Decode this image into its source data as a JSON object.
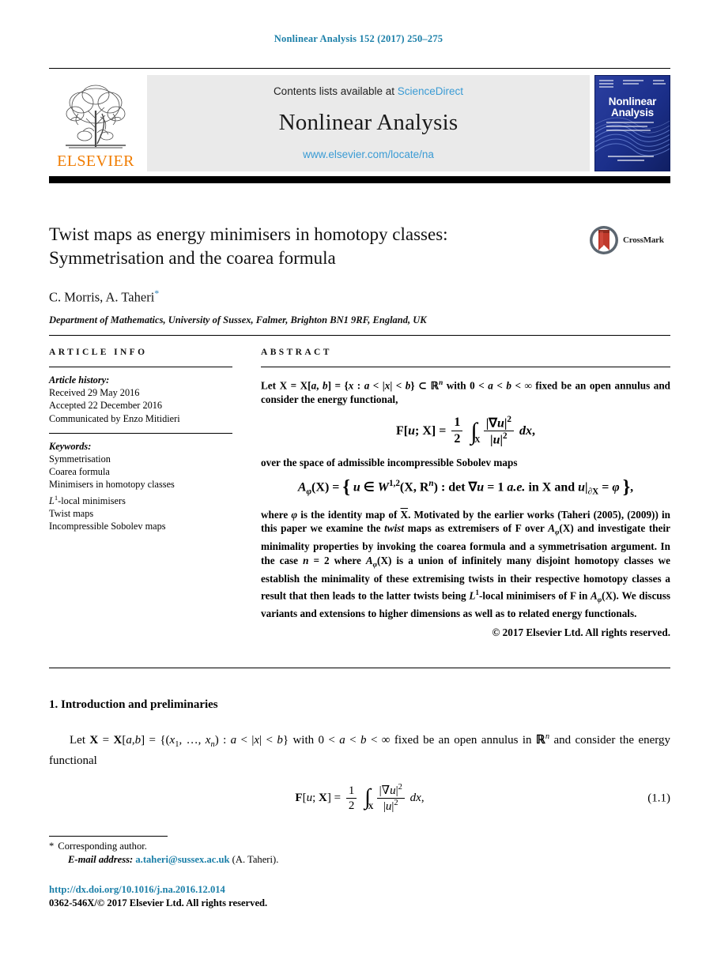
{
  "running_head": "Nonlinear Analysis 152 (2017) 250–275",
  "masthead": {
    "contents_text": "Contents lists available at ",
    "sciencedirect": "ScienceDirect",
    "journal_title": "Nonlinear Analysis",
    "journal_url": "www.elsevier.com/locate/na",
    "publisher_wordmark": "ELSEVIER",
    "cover_title_line1": "Nonlinear",
    "cover_title_line2": "Analysis",
    "link_color": "#3a9bd4",
    "cover_color": "#1b2f8a",
    "elsevier_orange": "#f07c00"
  },
  "article": {
    "title_line1": "Twist maps as energy minimisers in homotopy classes:",
    "title_line2": "Symmetrisation and the coarea formula",
    "authors": "C. Morris, A. Taheri",
    "author_star": "*",
    "affiliation": "Department of Mathematics, University of Sussex, Falmer, Brighton BN1 9RF, England, UK",
    "crossmark_label": "CrossMark"
  },
  "info": {
    "heading": "ARTICLE INFO",
    "history_label": "Article history:",
    "history": [
      "Received 29 May 2016",
      "Accepted 22 December 2016",
      "Communicated by Enzo Mitidieri"
    ],
    "keywords_label": "Keywords:",
    "keywords": [
      "Symmetrisation",
      "Coarea formula",
      "Minimisers in homotopy classes",
      "L¹-local minimisers",
      "Twist maps",
      "Incompressible Sobolev maps"
    ]
  },
  "abstract": {
    "heading": "ABSTRACT",
    "para1_pre": "Let ",
    "para1": "Let X = X[a, b] = {x : a < |x| < b} ⊂ ℝⁿ with 0 < a < b < ∞ fixed be an open annulus and consider the energy functional,",
    "eq1_plain": "F[u; X] = 1/2 ∫_X |∇u|² / |u|² dx,",
    "para2": "over the space of admissible incompressible Sobolev maps",
    "eq2_plain": "A_φ(X) = { u ∈ W^{1,2}(X, ℝⁿ) : det ∇u = 1 a.e. in X and u|∂X = φ },",
    "para3": "where φ is the identity map of X̄. Motivated by the earlier works (Taheri (2005), (2009)) in this paper we examine the twist maps as extremisers of F over A_φ(X) and investigate their minimality properties by invoking the coarea formula and a symmetrisation argument. In the case n = 2 where A_φ(X) is a union of infinitely many disjoint homotopy classes we establish the minimality of these extremising twists in their respective homotopy classes a result that then leads to the latter twists being L¹-local minimisers of F in A_φ(X). We discuss variants and extensions to higher dimensions as well as to related energy functionals.",
    "copyright": "© 2017 Elsevier Ltd. All rights reserved."
  },
  "section1": {
    "heading": "1. Introduction and preliminaries",
    "para_plain": "Let X = X[a, b] = {(x₁, …, xₙ) : a < |x| < b} with 0 < a < b < ∞ fixed be an open annulus in ℝⁿ and consider the energy functional",
    "equation_number": "(1.1)",
    "eq_plain": "F[u; X] = 1/2 ∫_X |∇u|²/|u|² dx,"
  },
  "footnotes": {
    "star": "*",
    "corresponding": "Corresponding author.",
    "email_label": "E-mail address:",
    "email": "a.taheri@sussex.ac.uk",
    "email_owner": "(A. Taheri)."
  },
  "footer": {
    "doi": "http://dx.doi.org/10.1016/j.na.2016.12.014",
    "issn_line": "0362-546X/© 2017 Elsevier Ltd. All rights reserved."
  }
}
